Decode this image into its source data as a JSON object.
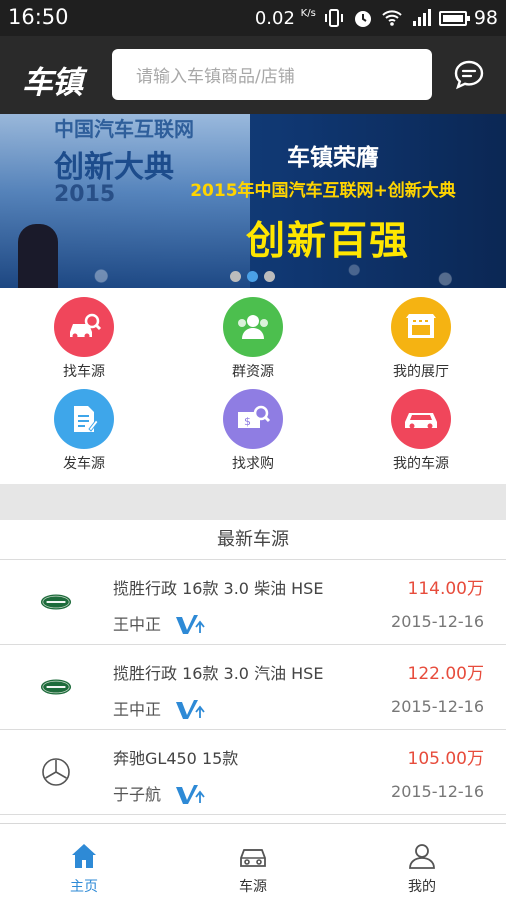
{
  "status_bar": {
    "time": "16:50",
    "net_speed": "0.02",
    "net_unit": "K/s",
    "battery": "98"
  },
  "header": {
    "logo": "车镇",
    "search_placeholder": "请输入车镇商品/店铺"
  },
  "banner": {
    "left_line1": "中国汽车互联网",
    "left_line2": "创新大典",
    "left_year": "2015",
    "title": "车镇荣膺",
    "subtitle": "2015年中国汽车互联网+创新大典",
    "headline": "创新百强",
    "active_dot": 1
  },
  "shortcuts": [
    {
      "label": "找车源",
      "color": "#f0465b",
      "icon": "car-search-icon"
    },
    {
      "label": "群资源",
      "color": "#4cbf4e",
      "icon": "group-icon"
    },
    {
      "label": "我的展厅",
      "color": "#f5b312",
      "icon": "showroom-icon"
    },
    {
      "label": "发车源",
      "color": "#3ea6ea",
      "icon": "document-edit-icon"
    },
    {
      "label": "找求购",
      "color": "#8f7de3",
      "icon": "money-search-icon"
    },
    {
      "label": "我的车源",
      "color": "#f0465b",
      "icon": "car-icon"
    }
  ],
  "latest": {
    "title": "最新车源",
    "items": [
      {
        "brand": "Land Rover",
        "name": "揽胜行政 16款 3.0 柴油 HSE",
        "price": "114.00万",
        "seller": "王中正",
        "date": "2015-12-16"
      },
      {
        "brand": "Land Rover",
        "name": "揽胜行政 16款 3.0 汽油 HSE",
        "price": "122.00万",
        "seller": "王中正",
        "date": "2015-12-16"
      },
      {
        "brand": "Mercedes-Benz",
        "name": "奔驰GL450 15款",
        "price": "105.00万",
        "seller": "于子航",
        "date": "2015-12-16"
      }
    ]
  },
  "tabbar": {
    "tabs": [
      {
        "label": "主页",
        "active": true
      },
      {
        "label": "车源",
        "active": false
      },
      {
        "label": "我的",
        "active": false
      }
    ],
    "active_color": "#2e8ad6"
  }
}
